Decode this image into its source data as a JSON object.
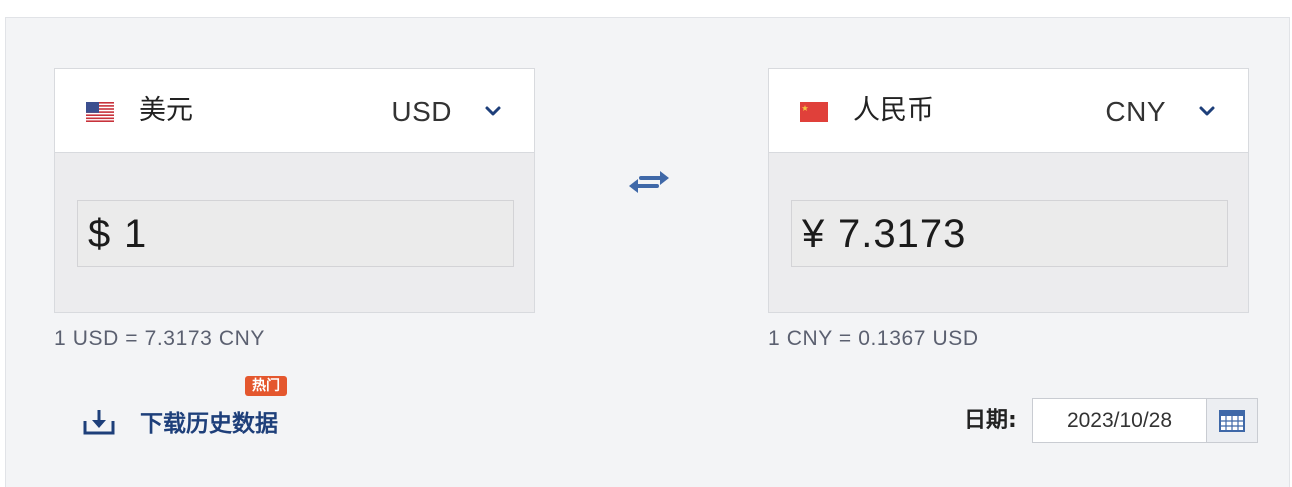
{
  "from_currency": {
    "flag": "us-flag-icon",
    "name": "美元",
    "code": "USD",
    "symbol": "$",
    "amount": "1",
    "rate_text": "1 USD = 7.3173 CNY"
  },
  "to_currency": {
    "flag": "cn-flag-icon",
    "name": "人民币",
    "code": "CNY",
    "symbol": "¥",
    "amount": "7.3173",
    "rate_text": "1 CNY = 0.1367 USD"
  },
  "icons": {
    "swap": "swap-arrows-icon",
    "dropdown": "chevron-down-icon",
    "download": "download-icon",
    "calendar": "calendar-icon"
  },
  "download": {
    "label": "下载历史数据",
    "badge": "热门"
  },
  "date": {
    "label": "日期:",
    "value": "2023/10/28"
  },
  "colors": {
    "accent": "#1e3f7a",
    "badge": "#e4572e",
    "swap_icon": "#3f68a8"
  }
}
